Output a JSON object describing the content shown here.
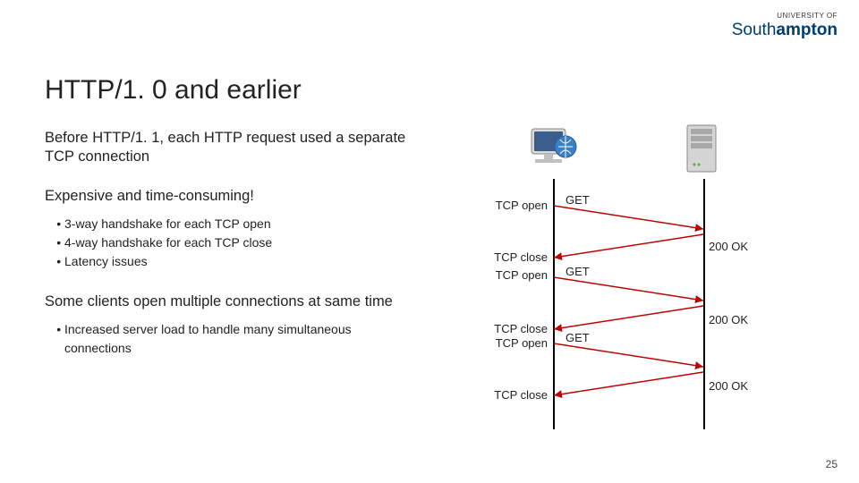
{
  "logo": {
    "prefix": "UNIVERSITY OF",
    "name_pre": "South",
    "name_bold": "ampton"
  },
  "title": "HTTP/1. 0 and earlier",
  "para1": "Before HTTP/1. 1, each HTTP request used a separate TCP connection",
  "para2": "Expensive and time-consuming!",
  "bullets1": {
    "b1": "3-way handshake for each TCP open",
    "b2": "4-way handshake for each TCP close",
    "b3": "Latency issues"
  },
  "para3": "Some clients open multiple connections at same time",
  "bullets2": {
    "b1": "Increased server load to handle many simultaneous connections"
  },
  "diagram": {
    "tcp_open": "TCP open",
    "tcp_close": "TCP close",
    "get": "GET",
    "ok": "200 OK"
  },
  "page_number": "25"
}
